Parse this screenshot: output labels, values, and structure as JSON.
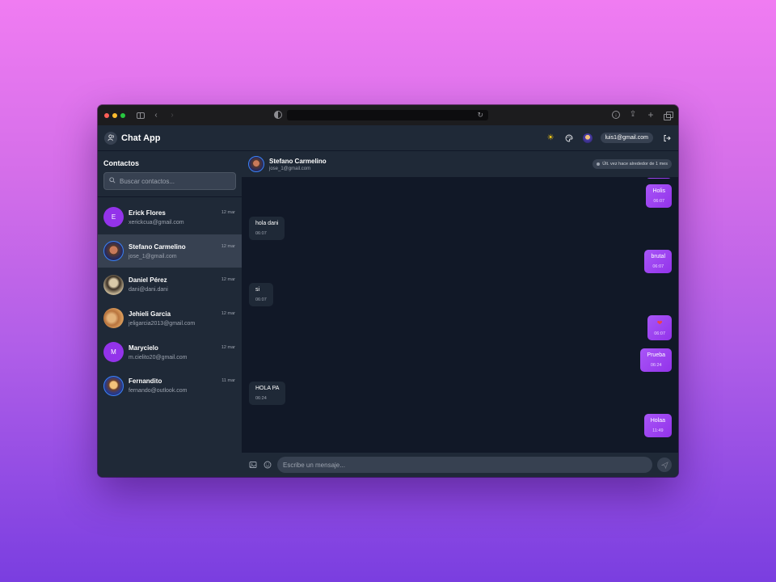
{
  "app": {
    "title": "Chat App",
    "user_email": "luis1@gmail.com"
  },
  "browser": {
    "url": ""
  },
  "sidebar": {
    "title": "Contactos",
    "search_placeholder": "Buscar contactos...",
    "contacts": [
      {
        "name": "Erick Flores",
        "email": "xerickcua@gmail.com",
        "date": "12 mar",
        "initial": "E"
      },
      {
        "name": "Stefano Carmelino",
        "email": "jose_1@gmail.com",
        "date": "12 mar",
        "initial": ""
      },
      {
        "name": "Daniel Pérez",
        "email": "dani@dani.dani",
        "date": "12 mar",
        "initial": ""
      },
      {
        "name": "Jehieli Garcia",
        "email": "jeligarcia2013@gmail.com",
        "date": "12 mar",
        "initial": ""
      },
      {
        "name": "Marycielo",
        "email": "m.cielito20@gmail.com",
        "date": "12 mar",
        "initial": "M"
      },
      {
        "name": "Fernandito",
        "email": "fernando@outlook.com",
        "date": "11 mar",
        "initial": ""
      }
    ]
  },
  "chat": {
    "contact_name": "Stefano Carmelino",
    "contact_email": "jose_1@gmail.com",
    "last_seen": "Últ. vez hace alrededor de 1 mes",
    "messages": [
      {
        "dir": "out",
        "text": "Holis",
        "time": "06:07"
      },
      {
        "dir": "in",
        "text": "hola dani",
        "time": "06:07"
      },
      {
        "dir": "out",
        "text": "brutal",
        "time": "06:07"
      },
      {
        "dir": "in",
        "text": "si",
        "time": "06:07"
      },
      {
        "dir": "out",
        "text": "❤",
        "time": "06:07"
      },
      {
        "dir": "out",
        "text": "Prueba",
        "time": "06:24"
      },
      {
        "dir": "in",
        "text": "HOLA PA",
        "time": "06:24"
      },
      {
        "dir": "out",
        "text": "Holaa",
        "time": "11:49"
      }
    ],
    "input_placeholder": "Escribe un mensaje..."
  },
  "colors": {
    "accent": "#9333ea",
    "background": "#111827",
    "panel": "#1f2937"
  }
}
